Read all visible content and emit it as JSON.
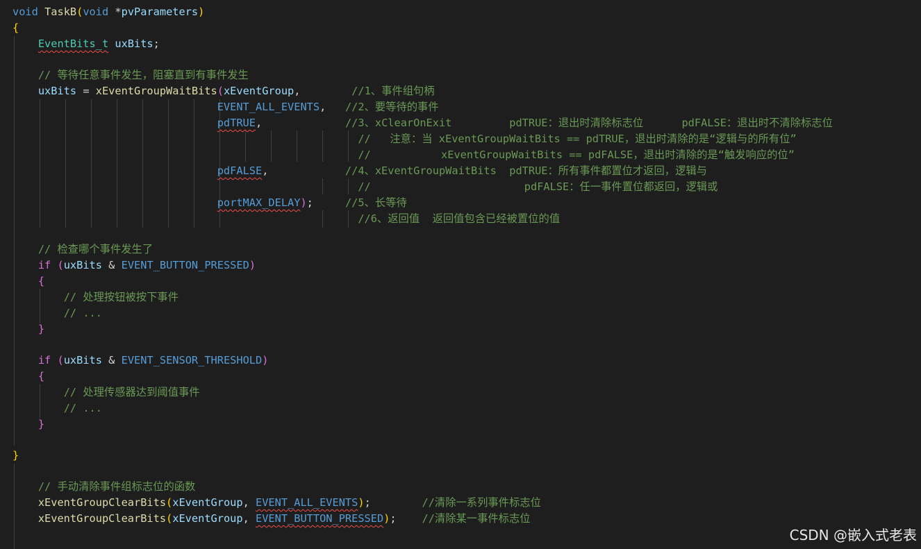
{
  "code": {
    "l1": {
      "kw": "void",
      "fn": "TaskB",
      "p1": "(",
      "kw2": "void",
      "rest": " *",
      "var": "pvParameters",
      "p2": ")"
    },
    "l2": {
      "b": "{"
    },
    "l3": {
      "typ": "EventBits_t",
      "rest": " ",
      "var": "uxBits",
      "end": ";"
    },
    "l5": {
      "cm": "// 等待任意事件发生，阻塞直到有事件发生"
    },
    "l6": {
      "var": "uxBits",
      "eq": " = ",
      "fn": "xEventGroupWaitBits",
      "p": "(",
      "arg": "xEventGroup",
      "tail": ",",
      "cm": "//1、事件组句柄"
    },
    "l7": {
      "mac": "EVENT_ALL_EVENTS",
      "tail": ",",
      "cm": "//2、要等待的事件"
    },
    "l8": {
      "mac": "pdTRUE",
      "tail": ",",
      "cm": "//3、xClearOnExit         pdTRUE：退出时清除标志位      pdFALSE：退出时不清除标志位"
    },
    "l9": {
      "cm": "//   注意：当 xEventGroupWaitBits == pdTRUE，退出时清除的是“逻辑与的所有位”"
    },
    "l10": {
      "cm": "//           xEventGroupWaitBits == pdFALSE，退出时清除的是“触发响应的位”"
    },
    "l11": {
      "mac": "pdFALSE",
      "tail": ",",
      "cm": "//4、xEventGroupWaitBits  pdTRUE：所有事件都置位才返回，逻辑与"
    },
    "l12": {
      "cm": "//                        pdFALSE：任一事件置位都返回，逻辑或"
    },
    "l13": {
      "mac": "portMAX_DELAY",
      "p": ")",
      "tail": ";",
      "cm": "//5、长等待"
    },
    "l14": {
      "cm": "//6、返回值  返回值包含已经被置位的值"
    },
    "l16": {
      "cm": "// 检查哪个事件发生了"
    },
    "l17": {
      "kw": "if",
      "sp": " ",
      "p": "(",
      "var": "uxBits",
      "op": " & ",
      "mac": "EVENT_BUTTON_PRESSED",
      "p2": ")"
    },
    "l18": {
      "b": "{"
    },
    "l19": {
      "cm": "// 处理按钮被按下事件"
    },
    "l20": {
      "cm": "// ..."
    },
    "l21": {
      "b": "}"
    },
    "l23": {
      "kw": "if",
      "sp": " ",
      "p": "(",
      "var": "uxBits",
      "op": " & ",
      "mac": "EVENT_SENSOR_THRESHOLD",
      "p2": ")"
    },
    "l24": {
      "b": "{"
    },
    "l25": {
      "cm": "// 处理传感器达到阈值事件"
    },
    "l26": {
      "cm": "// ..."
    },
    "l27": {
      "b": "}"
    },
    "l29": {
      "b": "}"
    },
    "l31": {
      "cm": "// 手动清除事件组标志位的函数"
    },
    "l32": {
      "fn": "xEventGroupClearBits",
      "p": "(",
      "arg": "xEventGroup",
      "sep": ", ",
      "mac": "EVENT_ALL_EVENTS",
      "p2": ")",
      "tail": ";",
      "cm": "//清除一系列事件标志位"
    },
    "l33": {
      "fn": "xEventGroupClearBits",
      "p": "(",
      "arg": "xEventGroup",
      "sep": ", ",
      "mac": "EVENT_BUTTON_PRESSED",
      "p2": ")",
      "tail": ";",
      "cm": "//清除某一事件标志位"
    }
  },
  "watermark": "CSDN @嵌入式老表",
  "colors": {
    "keyword": "#569cd6",
    "function": "#dcdcaa",
    "variable": "#9cdcfe",
    "type": "#4ec9b0",
    "comment": "#6a9955",
    "background": "#1e1e1e"
  }
}
